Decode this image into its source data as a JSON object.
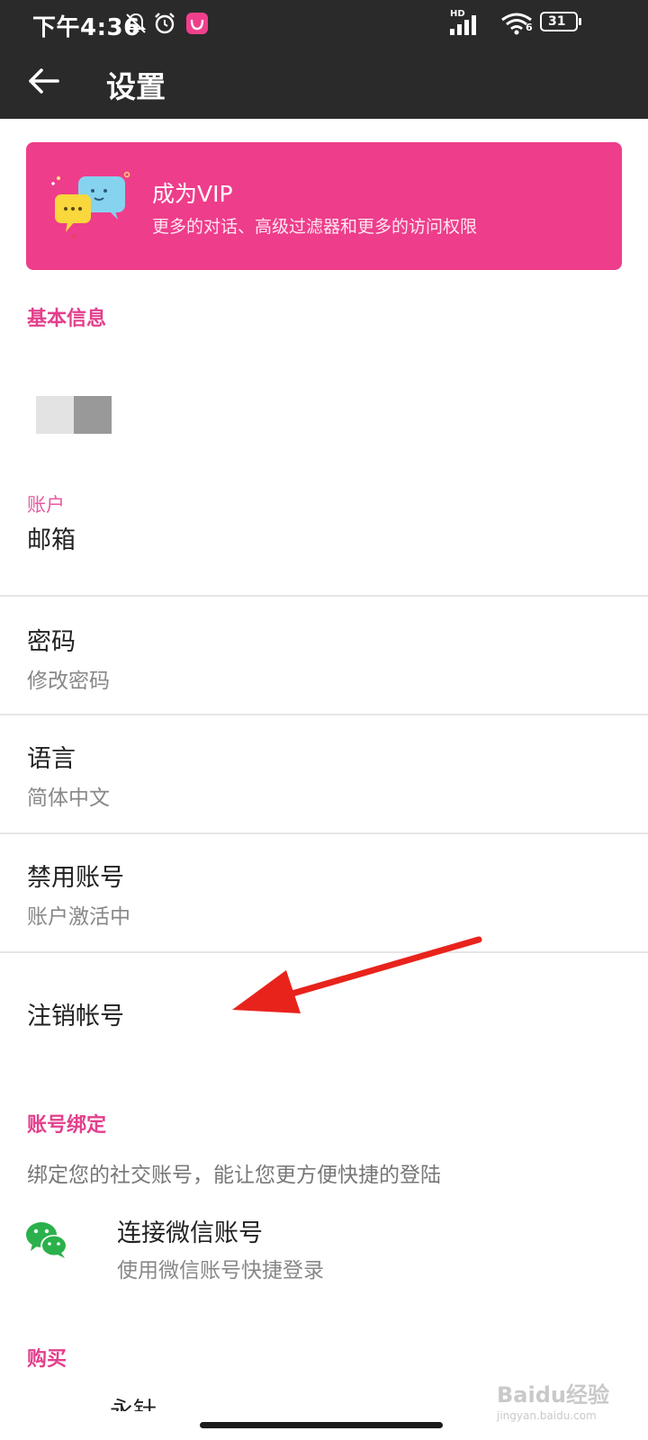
{
  "status_bar": {
    "time": "下午4:36",
    "network_label": "HD",
    "wifi_number": "6",
    "battery": "31",
    "icons": [
      "bell-off-icon",
      "alarm-icon",
      "app-notification-icon",
      "signal-icon",
      "wifi-icon",
      "battery-icon"
    ]
  },
  "app_bar": {
    "title": "设置",
    "back_icon": "arrow-left-icon"
  },
  "vip_banner": {
    "title": "成为VIP",
    "subtitle": "更多的对话、高级过滤器和更多的访问权限",
    "color": "#ee3d8b"
  },
  "sections": {
    "basic_info": "基本信息",
    "account": "账户",
    "binding": "账号绑定",
    "purchase": "购买"
  },
  "account_rows": {
    "email": {
      "title": "邮箱"
    },
    "password": {
      "title": "密码",
      "subtitle": "修改密码"
    },
    "language": {
      "title": "语言",
      "subtitle": "简体中文"
    },
    "disable": {
      "title": "禁用账号",
      "subtitle": "账户激活中"
    },
    "cancel": {
      "title": "注销帐号"
    }
  },
  "binding": {
    "description": "绑定您的社交账号，能让您更方便快捷的登陆",
    "wechat": {
      "title": "连接微信账号",
      "subtitle": "使用微信账号快捷登录",
      "icon": "wechat-icon",
      "color": "#2ab14b"
    }
  },
  "purchase_partial": "永针",
  "watermark": {
    "logo": "Baidu经验",
    "url": "jingyan.baidu.com"
  },
  "accent_color": "#e33f8c",
  "annotation_color": "#e8231c"
}
